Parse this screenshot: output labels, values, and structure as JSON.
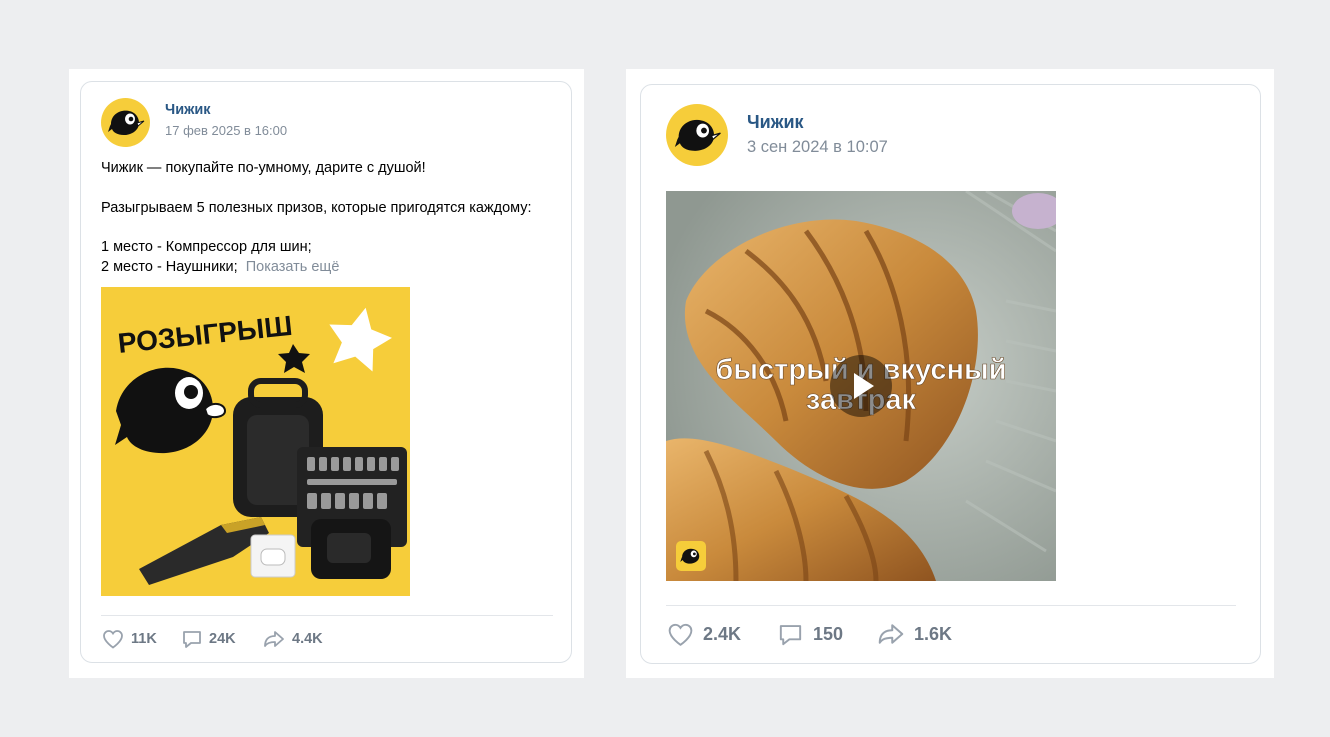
{
  "posts": [
    {
      "author": "Чижик",
      "date": "17 фев 2025 в 16:00",
      "text_lines": [
        "Чижик — покупайте по-умному, дарите с душой!",
        "Разыгрываем 5 полезных призов, которые пригодятся каждому:",
        "1 место - Компрессор для шин;",
        "2 место - Наушники;"
      ],
      "show_more": "Показать ещё",
      "image_title": "РОЗЫГРЫШ",
      "likes": "11K",
      "comments": "24K",
      "shares": "4.4K"
    },
    {
      "author": "Чижик",
      "date": "3 сен 2024 в 10:07",
      "video_caption_line1": "быстрый и вкусный",
      "video_caption_line2": "завтрак",
      "likes": "2.4K",
      "comments": "150",
      "shares": "1.6K"
    }
  ],
  "colors": {
    "page_bg": "#edeef0",
    "brand_yellow": "#f6cd3a",
    "author_link": "#2a5885",
    "meta_gray": "#818c99"
  },
  "icons": [
    "bird-logo-icon",
    "heart-icon",
    "comment-icon",
    "share-icon",
    "play-icon",
    "star-icon"
  ]
}
